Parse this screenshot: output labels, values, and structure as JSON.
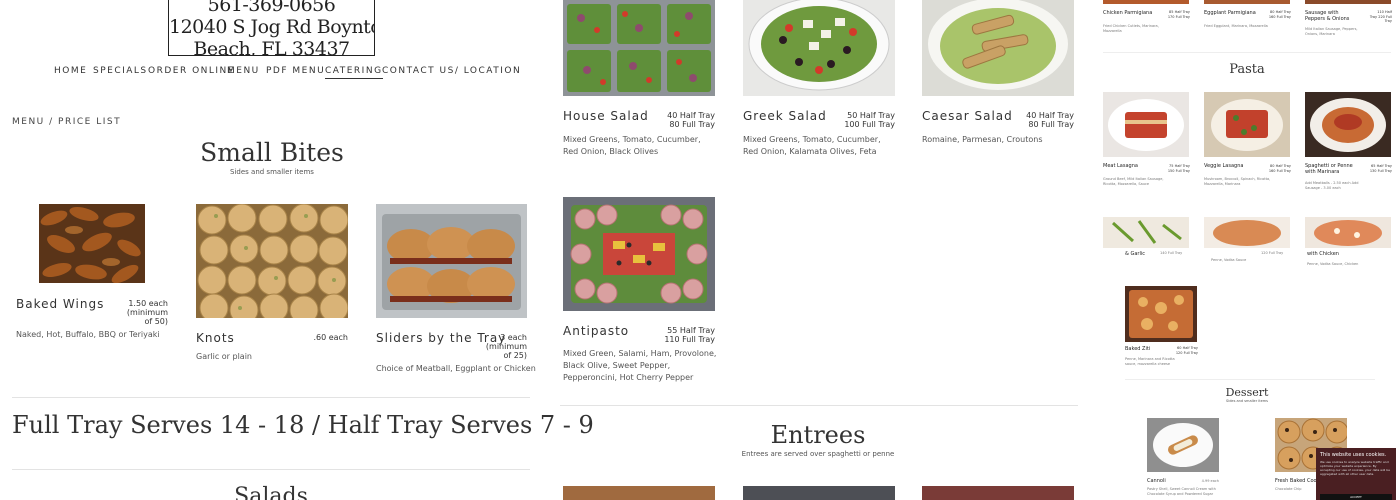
{
  "header": {
    "address_lines": [
      "561-369-0656",
      "12040 S Jog Rd Boynton",
      "Beach, FL 33437"
    ],
    "nav": [
      "HOME",
      "SPECIALS",
      "ORDER ONLINE",
      "MENU",
      "PDF MENU",
      "CATERING",
      "CONTACT US/ LOCATION"
    ],
    "active_nav": "CATERING"
  },
  "breadcrumb": "MENU / PRICE LIST",
  "small_bites": {
    "title": "Small Bites",
    "subtitle": "Sides and smaller items",
    "items": [
      {
        "name": "Baked Wings",
        "price": [
          "1.50 each",
          "(minimum",
          "of 50)"
        ],
        "desc": "Naked, Hot, Buffalo, BBQ or Teriyaki"
      },
      {
        "name": "Knots",
        "price": [
          ".60 each"
        ],
        "desc": "Garlic or plain"
      },
      {
        "name": "Sliders by the Tray",
        "price": [
          "3 each",
          "(minimum",
          "of 25)"
        ],
        "desc": "Choice of Meatball, Eggplant or Chicken"
      }
    ]
  },
  "serves_banner": "Full Tray Serves 14 - 18 / Half Tray Serves 7 - 9",
  "salads_title": "Salads",
  "salads": [
    {
      "name": "House Salad",
      "price": [
        "40 Half Tray",
        "80 Full Tray"
      ],
      "desc": "Mixed Greens, Tomato, Cucumber, Red Onion, Black Olives"
    },
    {
      "name": "Greek Salad",
      "price": [
        "50 Half Tray",
        "100 Full Tray"
      ],
      "desc": "Mixed Greens, Tomato, Cucumber, Red Onion, Kalamata Olives, Feta"
    },
    {
      "name": "Caesar Salad",
      "price": [
        "40 Half Tray",
        "80 Full Tray"
      ],
      "desc": "Romaine, Parmesan, Croutons"
    },
    {
      "name": "Antipasto",
      "price": [
        "55 Half Tray",
        "110 Full Tray"
      ],
      "desc": "Mixed Green, Salami, Ham, Provolone, Black Olive, Sweet Pepper, Pepperoncini, Hot Cherry Pepper"
    }
  ],
  "entrees": {
    "title": "Entrees",
    "subtitle": "Entrees are served over spaghetti or penne"
  },
  "right_column": {
    "top_items": [
      {
        "name": "Chicken Parmigiana",
        "price": [
          "85 Half Tray",
          "170 Full Tray"
        ],
        "desc": "Fried Chicken Cutlets, Marinara, Mozzarella"
      },
      {
        "name": "Eggplant Parmigiana",
        "price": [
          "80 Half Tray",
          "160 Full Tray"
        ],
        "desc": "Fried Eggplant, Marinara, Mozzarella"
      },
      {
        "name": "Sausage with Peppers & Onions",
        "price": [
          "110 Half",
          "Tray 220 Full",
          "Tray"
        ],
        "desc": "Mild Italian Sausage, Peppers, Onions, Marinara"
      }
    ],
    "pasta_title": "Pasta",
    "pasta_items": [
      {
        "name": "Meat Lasagna",
        "price": [
          "75 Half Tray",
          "150 Full Tray"
        ],
        "desc": "Ground Beef, Mild Italian Sausage, Ricotta, Mozzarella, Sauce"
      },
      {
        "name": "Veggie Lasagna",
        "price": [
          "80 Half Tray",
          "160 Full Tray"
        ],
        "desc": "Mushroom, Broccoli, Spinach, Ricotta, Mozzarella, Marinara"
      },
      {
        "name": "Spaghetti or Penne with Marinara",
        "price": [
          "65 Half Tray",
          "130 Full Tray"
        ],
        "desc": "Add Meatballs - 2.50 each Add Sausage - 3.00 each"
      }
    ],
    "pasta_row2": [
      {
        "name": "& Garlic",
        "price": "140 Full Tray"
      },
      {
        "name": "Penne, Vodka Sauce",
        "price": "120 Full Tray"
      },
      {
        "name": "with Chicken",
        "price": "Penne, Vodka Sauce, Chicken"
      }
    ],
    "baked_ziti": {
      "name": "Baked Ziti",
      "price": [
        "60 Half Tray",
        "120 Full Tray"
      ],
      "desc": "Penne, Marinara and Ricotta sauce, mozzarella cheese"
    },
    "dessert_title": "Dessert",
    "dessert_subtitle": "Sides and smaller items",
    "desserts": [
      {
        "name": "Cannoli",
        "price": "4.99 each",
        "desc": "Pastry Shell, Sweet Cannoli Cream with Chocolate Syrup and Powdered Sugar"
      },
      {
        "name": "Fresh Baked Coo",
        "desc": "Chocolate Chip"
      }
    ]
  },
  "cookie": {
    "title": "This website uses cookies.",
    "body": "We use cookies to analyze website traffic and optimize your website experience. By accepting our use of cookies, your data will be aggregated with all other user data.",
    "button": "ACCEPT"
  },
  "colors": {
    "cookie_bg": "#4a1f22",
    "text": "#333333",
    "divider": "#e3e3e3"
  }
}
